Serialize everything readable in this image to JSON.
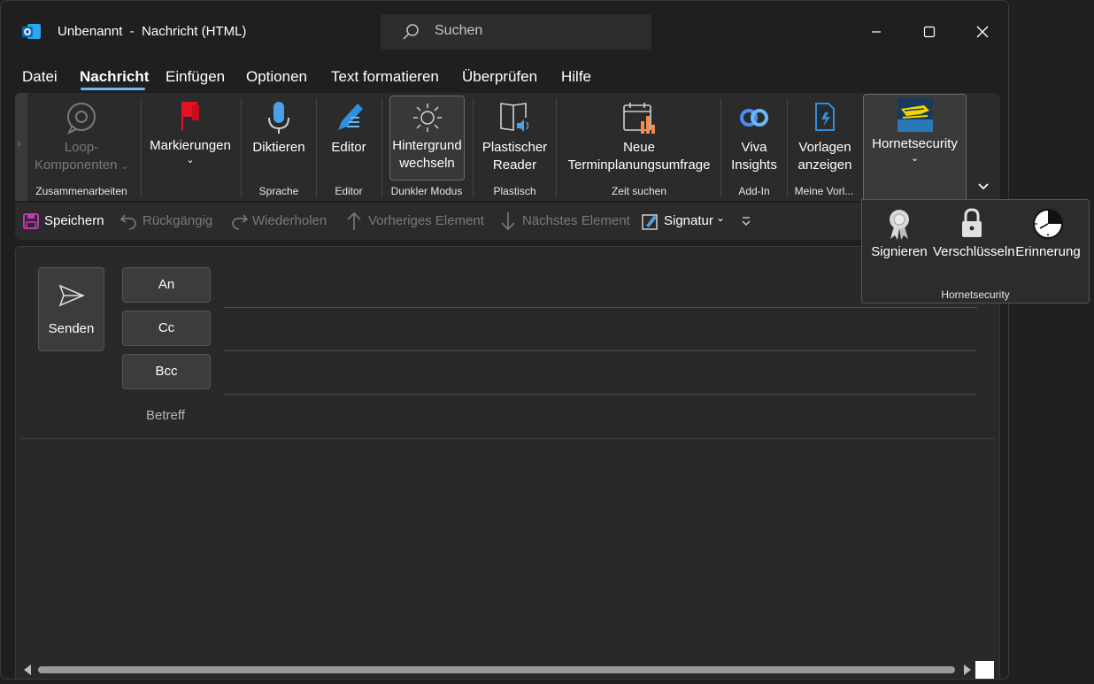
{
  "window": {
    "title": "Unbenannt  -  Nachricht (HTML)",
    "search_placeholder": "Suchen"
  },
  "menu": {
    "items": [
      "Datei",
      "Nachricht",
      "Einfügen",
      "Optionen",
      "Text formatieren",
      "Überprüfen",
      "Hilfe"
    ],
    "active": "Nachricht"
  },
  "ribbon": {
    "loop": {
      "line1": "Loop-",
      "line2": "Komponenten",
      "group": "Zusammenarbeiten"
    },
    "markierungen": {
      "label": "Markierungen"
    },
    "diktieren": {
      "label": "Diktieren",
      "group": "Sprache"
    },
    "editor": {
      "label": "Editor",
      "group": "Editor"
    },
    "hintergrund": {
      "line1": "Hintergrund",
      "line2": "wechseln",
      "group": "Dunkler Modus"
    },
    "plastischer": {
      "line1": "Plastischer",
      "line2": "Reader",
      "group": "Plastisch"
    },
    "umfrage": {
      "line1": "Neue",
      "line2": "Terminplanungsumfrage",
      "group": "Zeit suchen"
    },
    "viva": {
      "line1": "Viva",
      "line2": "Insights",
      "group": "Add-In"
    },
    "vorlagen": {
      "line1": "Vorlagen",
      "line2": "anzeigen",
      "group": "Meine Vorl..."
    },
    "hornet": {
      "label": "Hornetsecurity"
    }
  },
  "qat": {
    "save": "Speichern",
    "undo": "Rückgängig",
    "redo": "Wiederholen",
    "prev": "Vorheriges Element",
    "next": "Nächstes Element",
    "signature": "Signatur"
  },
  "compose": {
    "send": "Senden",
    "to": "An",
    "cc": "Cc",
    "bcc": "Bcc",
    "subject": "Betreff"
  },
  "hornet_panel": {
    "items": [
      "Signieren",
      "Verschlüsseln",
      "Erinnerung"
    ],
    "group": "Hornetsecurity"
  },
  "colors": {
    "accent": "#6cb8f6",
    "flag": "#e81123",
    "save": "#c239b3",
    "background": "#1f1f1f"
  }
}
